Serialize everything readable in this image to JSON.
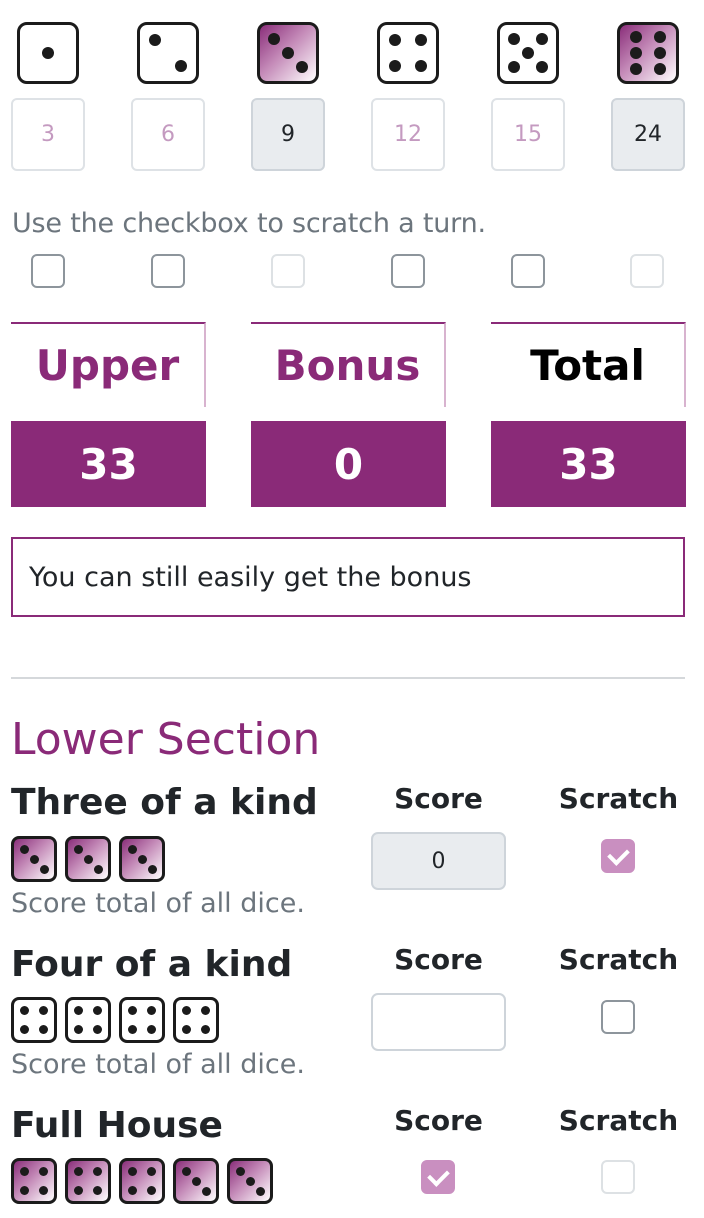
{
  "upper": {
    "dice": [
      {
        "face": 1,
        "filled": false,
        "score": "3",
        "used": false,
        "checkbox": "empty"
      },
      {
        "face": 2,
        "filled": false,
        "score": "6",
        "used": false,
        "checkbox": "empty"
      },
      {
        "face": 3,
        "filled": true,
        "score": "9",
        "used": true,
        "checkbox": "disabled"
      },
      {
        "face": 4,
        "filled": false,
        "score": "12",
        "used": false,
        "checkbox": "empty"
      },
      {
        "face": 5,
        "filled": false,
        "score": "15",
        "used": false,
        "checkbox": "empty"
      },
      {
        "face": 6,
        "filled": true,
        "score": "24",
        "used": true,
        "checkbox": "disabled"
      }
    ],
    "hint": "Use the checkbox to scratch a turn."
  },
  "totals": {
    "upper_label": "Upper",
    "upper_value": "33",
    "bonus_label": "Bonus",
    "bonus_value": "0",
    "total_label": "Total",
    "total_value": "33"
  },
  "message": "You can still easily get the bonus",
  "lower": {
    "title": "Lower Section",
    "score_label": "Score",
    "scratch_label": "Scratch",
    "rows": [
      {
        "title": "Three of a kind",
        "dice_faces": [
          3,
          3,
          3
        ],
        "dice_filled": true,
        "description": "Score total of all dice.",
        "score_value": "0",
        "score_used": true,
        "scratch": "checked"
      },
      {
        "title": "Four of a kind",
        "dice_faces": [
          4,
          4,
          4,
          4
        ],
        "dice_filled": false,
        "description": "Score total of all dice.",
        "score_value": "",
        "score_used": false,
        "scratch": "empty"
      },
      {
        "title": "Full House",
        "dice_faces": [
          4,
          4,
          4,
          3,
          3
        ],
        "dice_filled": true,
        "description": "",
        "score_value": "",
        "score_used": false,
        "score_check": "checked",
        "scratch": "disabled"
      }
    ]
  },
  "colors": {
    "accent": "#8a2a78",
    "muted": "#6c757d",
    "checked": "#c98fc0"
  }
}
